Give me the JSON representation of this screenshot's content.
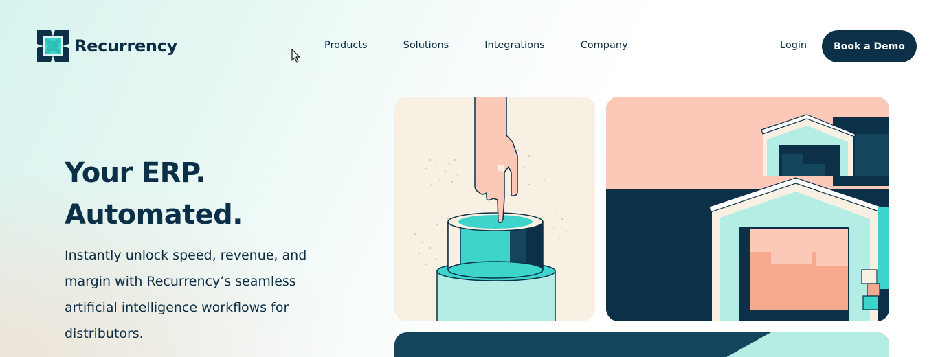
{
  "header": {
    "brand": "Recurrency",
    "nav": [
      "Products",
      "Solutions",
      "Integrations",
      "Company"
    ],
    "login_label": "Login",
    "cta_label": "Book a Demo"
  },
  "hero": {
    "headline_line1": "Your ERP.",
    "headline_line2": "Automated.",
    "subcopy_lines": [
      "Instantly unlock speed, revenue, and",
      "margin with Recurrency’s seamless",
      "artificial intelligence workflows for",
      "distributors."
    ]
  },
  "colors": {
    "navy": "#0b3048",
    "teal": "#3dd4cc",
    "mint": "#b3ede3",
    "peach": "#fcc8b8",
    "cream": "#f8f0e3"
  },
  "icons": [
    "recurrency-logo-icon",
    "cursor-arrow-icon"
  ]
}
